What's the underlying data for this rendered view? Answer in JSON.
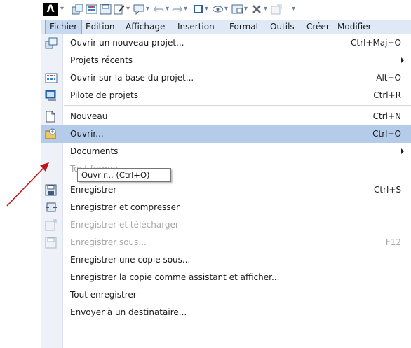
{
  "quick_access": {
    "logo": "Λ",
    "icons": [
      "project-icon",
      "grid-icon",
      "save-icon",
      "edit-icon",
      "chat-icon",
      "undo-icon",
      "redo-icon",
      "frame-icon",
      "eye-icon",
      "layout-icon",
      "tools-icon",
      "export-icon",
      "customize-icon"
    ]
  },
  "menubar": {
    "items": [
      "Fichier",
      "Edition",
      "Affichage",
      "Insertion",
      "Format",
      "Outils",
      "Créer",
      "Modifier"
    ]
  },
  "menu": {
    "items": [
      {
        "label": "Ouvrir un nouveau projet...",
        "shortcut": "Ctrl+Maj+O",
        "icon": "new-project-icon"
      },
      {
        "label": "Projets récents",
        "shortcut": "",
        "submenu": true
      },
      {
        "label": "Ouvrir sur la base du projet...",
        "shortcut": "Alt+O",
        "icon": "grid-project-icon"
      },
      {
        "label": "Pilote de projets",
        "shortcut": "Ctrl+R",
        "icon": "project-pilot-icon"
      },
      {
        "label": "Nouveau",
        "shortcut": "Ctrl+N",
        "icon": "new-document-icon"
      },
      {
        "label": "Ouvrir...",
        "shortcut": "Ctrl+O",
        "icon": "open-folder-icon",
        "highlighted": true
      },
      {
        "label": "Documents",
        "shortcut": "",
        "submenu": true
      },
      {
        "label": "Tout fermer",
        "shortcut": "",
        "disabled": true
      },
      {
        "label": "Enregistrer",
        "shortcut": "Ctrl+S",
        "icon": "save-icon"
      },
      {
        "label": "Enregistrer et compresser",
        "shortcut": "",
        "icon": "compress-icon"
      },
      {
        "label": "Enregistrer et télécharger",
        "shortcut": "",
        "icon": "upload-icon",
        "disabled": true
      },
      {
        "label": "Enregistrer sous...",
        "shortcut": "F12",
        "icon": "save-as-icon",
        "disabled": true
      },
      {
        "label": "Enregistrer une copie sous...",
        "shortcut": ""
      },
      {
        "label": "Enregistrer la copie comme assistant et afficher...",
        "shortcut": ""
      },
      {
        "label": "Tout enregistrer",
        "shortcut": ""
      },
      {
        "label": "Envoyer à un destinataire...",
        "shortcut": ""
      }
    ]
  },
  "tooltip": {
    "text": "Ouvrir... (Ctrl+O)"
  },
  "colors": {
    "menubar": "#dfe8f5",
    "highlight": "#b4cbea",
    "annotation_arrow": "#c0141c"
  }
}
